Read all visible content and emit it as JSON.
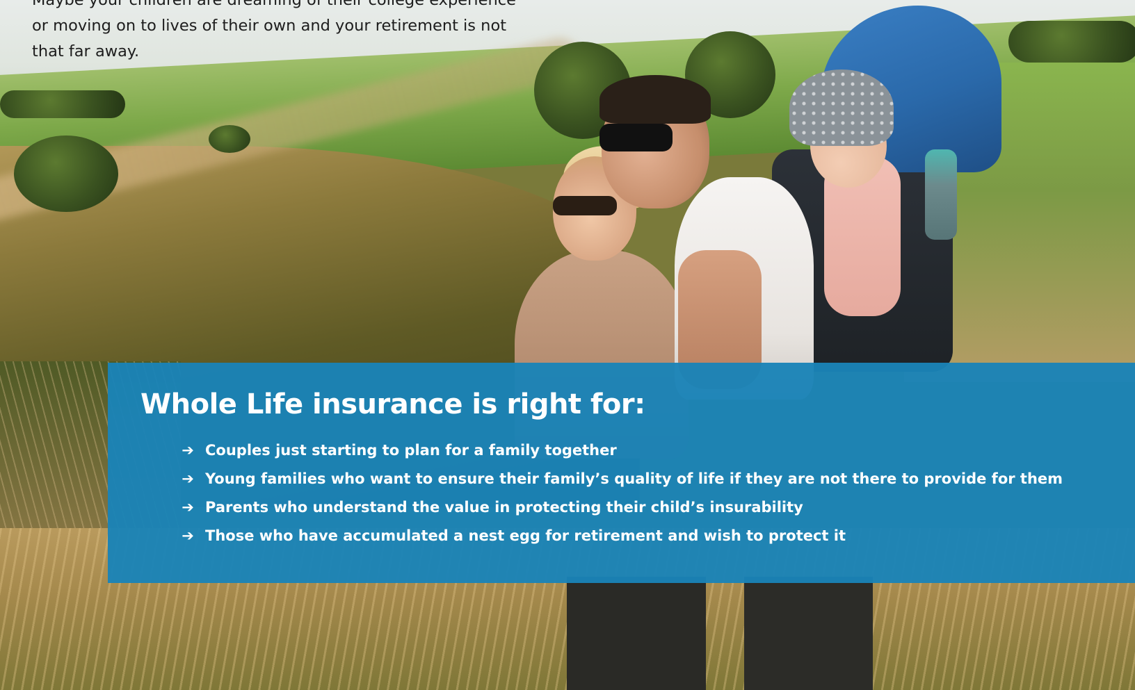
{
  "intro": {
    "line1": "Maybe your children are dreaming of their college experience",
    "line2": "or moving on to lives of their own and your retirement is not",
    "line3": "that far away."
  },
  "panel": {
    "title": "Whole Life insurance is right for:",
    "bullet_icon": "arrow-right-icon",
    "items": [
      {
        "label": "Couples just starting to plan for a family together"
      },
      {
        "label": "Young families who want to ensure their family’s quality of life if they are not there to provide for them"
      },
      {
        "label": "Parents who understand the value in protecting their child’s insurability"
      },
      {
        "label": "Those who have accumulated a nest egg for retirement and wish to protect it"
      }
    ],
    "background_color": "#1a83b7",
    "text_color": "#ffffff"
  }
}
